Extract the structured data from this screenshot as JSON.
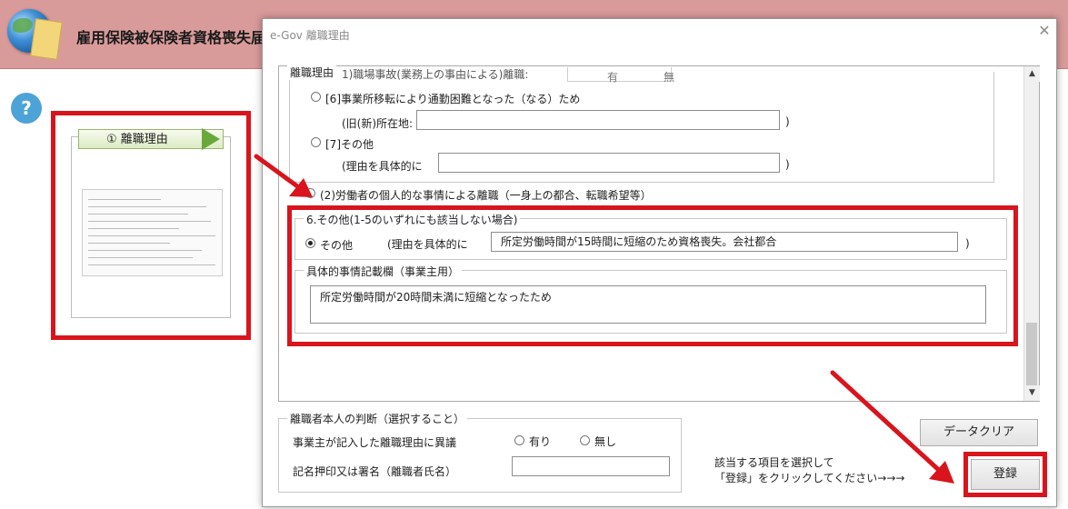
{
  "app": {
    "title": "雇用保険被保険者資格喪失届",
    "help_label": "?"
  },
  "step": {
    "label": "① 離職理由"
  },
  "dialog": {
    "title": "e-Gov  離職理由",
    "close_label": "✕"
  },
  "reason_section": {
    "legend": "離職理由",
    "top_cut_text": "1)職場事故(業務上の事由による)離職:",
    "top_cut_opt1": "有",
    "top_cut_opt2": "無",
    "opt6_label": "[6]事業所移転により通勤困難となった（なる）ため",
    "opt6_addr_label": "(旧(新)所在地:",
    "opt6_close": ")",
    "opt7_label": "[7]その他",
    "opt7_reason_label": "(理由を具体的に",
    "opt7_close": ")",
    "opt_personal_label": "(2)労働者の個人的な事情による離職（一身上の都合、転職希望等）"
  },
  "other_section": {
    "legend": "6.その他(1-5のいずれにも該当しない場合)",
    "radio_label": "その他",
    "reason_label": "(理由を具体的に",
    "reason_value": "所定労働時間が15時間に短縮のため資格喪失。会社都合",
    "close": ")"
  },
  "detail_section": {
    "legend": "具体的事情記載欄（事業主用）",
    "value": "所定労働時間が20時間未満に短縮となったため"
  },
  "judgment": {
    "legend": "離職者本人の判断（選択すること）",
    "objection_label": "事業主が記入した離職理由に異議",
    "opt_yes": "有り",
    "opt_no": "無し",
    "signature_label": "記名押印又は署名（離職者氏名）",
    "signature_value": ""
  },
  "buttons": {
    "clear": "データクリア",
    "register": "登録"
  },
  "instruction": {
    "line1": "該当する項目を選択して",
    "line2": "「登録」をクリックしてください→→→"
  },
  "colors": {
    "highlight_red": "#d9141c",
    "header_bg": "#d99a9a",
    "help_blue": "#4ba3d8",
    "step_green": "#6aa83a"
  },
  "icons": {
    "app_logo": "globe-document-icon",
    "help": "question-circle-icon",
    "close": "close-icon",
    "scroll_up": "chevron-up-icon",
    "scroll_down": "chevron-down-icon",
    "step_arrow": "chevron-right-icon"
  }
}
